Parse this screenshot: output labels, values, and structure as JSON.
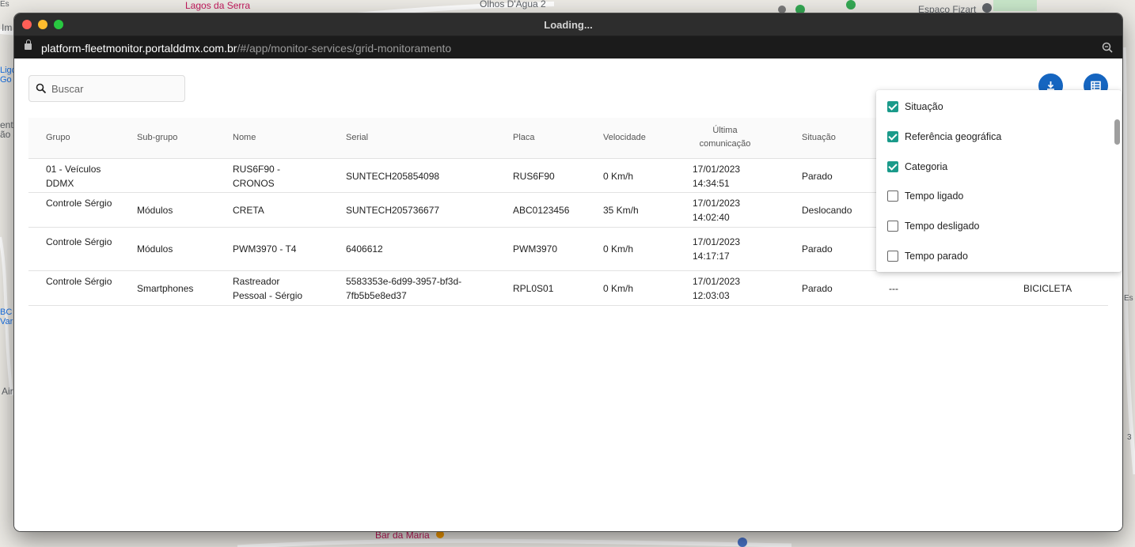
{
  "map": {
    "labels": [
      "Lagos da Serra",
      "Olhos D'Água 2",
      "Espaço Fizart",
      "Im",
      "Ligo",
      "Go",
      "ent",
      "ão J",
      "BC",
      "Var",
      "Air",
      "Bar da Maria",
      "Es",
      "Es",
      "3"
    ]
  },
  "window": {
    "title": "Loading...",
    "url_host": "platform-fleetmonitor.portalddmx.com.br",
    "url_path": "/#/app/monitor-services/grid-monitoramento"
  },
  "search": {
    "placeholder": "Buscar",
    "value": ""
  },
  "table": {
    "headers": [
      "Grupo",
      "Sub-grupo",
      "Nome",
      "Serial",
      "Placa",
      "Velocidade",
      "Última comunicação",
      "Situação"
    ],
    "rows": [
      [
        "01 - Veículos DDMX",
        "",
        "RUS6F90 - CRONOS",
        "SUNTECH205854098",
        "RUS6F90",
        "0 Km/h",
        "17/01/2023 14:34:51",
        "Parado",
        "",
        ""
      ],
      [
        "Controle Sérgio",
        "Módulos",
        "CRETA",
        "SUNTECH205736677",
        "ABC0123456",
        "35 Km/h",
        "17/01/2023 14:02:40",
        "Deslocando",
        "",
        ""
      ],
      [
        "Controle Sérgio",
        "Módulos",
        "PWM3970 - T4",
        "6406612",
        "PWM3970",
        "0 Km/h",
        "17/01/2023 14:17:17",
        "Parado",
        "",
        ""
      ],
      [
        "Controle Sérgio",
        "Smartphones",
        "Rastreador Pessoal - Sérgio",
        "5583353e-6d99-3957-bf3d-7fb5b5e8ed37",
        "RPL0S01",
        "0 Km/h",
        "17/01/2023 12:03:03",
        "Parado",
        "---",
        "BICICLETA"
      ]
    ]
  },
  "columns_menu": {
    "options": [
      {
        "label": "Situação",
        "checked": true
      },
      {
        "label": "Referência geográfica",
        "checked": true
      },
      {
        "label": "Categoria",
        "checked": true
      },
      {
        "label": "Tempo ligado",
        "checked": false
      },
      {
        "label": "Tempo desligado",
        "checked": false
      },
      {
        "label": "Tempo parado",
        "checked": false
      }
    ]
  },
  "colors": {
    "accent_button": "#1565c0",
    "checkbox_on": "#1a9a8a"
  },
  "icons": [
    "lock-icon",
    "zoom-icon",
    "search-icon",
    "download-icon",
    "table-columns-icon",
    "check-icon"
  ]
}
